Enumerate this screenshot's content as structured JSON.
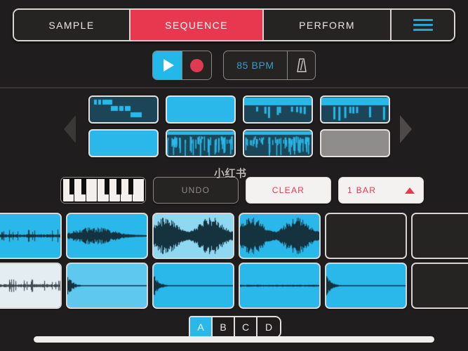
{
  "app": {
    "name": "sequence-view",
    "watermark": "小红书"
  },
  "tabs": [
    {
      "label": "SAMPLE",
      "active": false,
      "name": "tab-sample"
    },
    {
      "label": "SEQUENCE",
      "active": true,
      "name": "tab-sequence"
    },
    {
      "label": "PERFORM",
      "active": false,
      "name": "tab-perform"
    }
  ],
  "menu": {
    "icon": "hamburger-menu-icon",
    "label": ""
  },
  "transport": {
    "play": {
      "icon": "play-icon",
      "label": ""
    },
    "record": {
      "icon": "record-icon",
      "label": ""
    },
    "bpm": "85 BPM",
    "metronome": {
      "icon": "metronome-icon",
      "label": ""
    }
  },
  "pattern_nav": {
    "prev": {
      "icon": "chevron-left-icon"
    },
    "next": {
      "icon": "chevron-right-icon"
    }
  },
  "patterns": [
    {
      "index": 1,
      "state": "notes",
      "bg": "#1c4657",
      "selected": false
    },
    {
      "index": 2,
      "state": "filled",
      "bg": "#2ab8ea",
      "selected": false
    },
    {
      "index": 3,
      "state": "notes",
      "bg": "#1c4657",
      "selected": false
    },
    {
      "index": 4,
      "state": "notes",
      "bg": "#1c4657",
      "selected": false
    },
    {
      "index": 5,
      "state": "dense",
      "bg": "#2ab8ea",
      "selected": true
    },
    {
      "index": 6,
      "state": "dense-dark",
      "bg": "#1c4657",
      "selected": false
    },
    {
      "index": 7,
      "state": "dense-dark",
      "bg": "#1c4657",
      "selected": false
    },
    {
      "index": 8,
      "state": "empty",
      "bg": "#8f8d8b",
      "selected": false
    }
  ],
  "controls": {
    "piano": {
      "icon": "piano-keys-icon",
      "label": ""
    },
    "undo": "UNDO",
    "clear": "CLEAR",
    "bar_length": "1 BAR",
    "bar_arrow": "triangle-up-icon"
  },
  "pads": [
    {
      "index": 1,
      "state": "loaded",
      "bg": "#2ab8ea",
      "wave": "sparse"
    },
    {
      "index": 2,
      "state": "loaded",
      "bg": "#2ab8ea",
      "wave": "mid"
    },
    {
      "index": 3,
      "state": "loaded",
      "bg": "#8fd8f2",
      "wave": "loud"
    },
    {
      "index": 4,
      "state": "loaded",
      "bg": "#2ab8ea",
      "wave": "loud"
    },
    {
      "index": 5,
      "state": "empty",
      "bg": "#262323",
      "wave": "none"
    },
    {
      "index": 6,
      "state": "empty",
      "bg": "#262323",
      "wave": "none"
    },
    {
      "index": 7,
      "state": "loaded",
      "bg": "#e4eef2",
      "wave": "sparse"
    },
    {
      "index": 8,
      "state": "loaded",
      "bg": "#5ec8ee",
      "wave": "decay"
    },
    {
      "index": 9,
      "state": "loaded",
      "bg": "#2ab8ea",
      "wave": "decay"
    },
    {
      "index": 10,
      "state": "loaded",
      "bg": "#2ab8ea",
      "wave": "flat"
    },
    {
      "index": 11,
      "state": "loaded",
      "bg": "#2ab8ea",
      "wave": "decay"
    },
    {
      "index": 12,
      "state": "empty",
      "bg": "#262323",
      "wave": "none"
    }
  ],
  "banks": [
    {
      "label": "A",
      "active": true
    },
    {
      "label": "B",
      "active": false
    },
    {
      "label": "C",
      "active": false
    },
    {
      "label": "D",
      "active": false
    }
  ],
  "colors": {
    "accent_red": "#e8384f",
    "accent_cyan": "#2ab8ea",
    "background": "#1f1d1d",
    "outline": "#d8d5d2"
  }
}
